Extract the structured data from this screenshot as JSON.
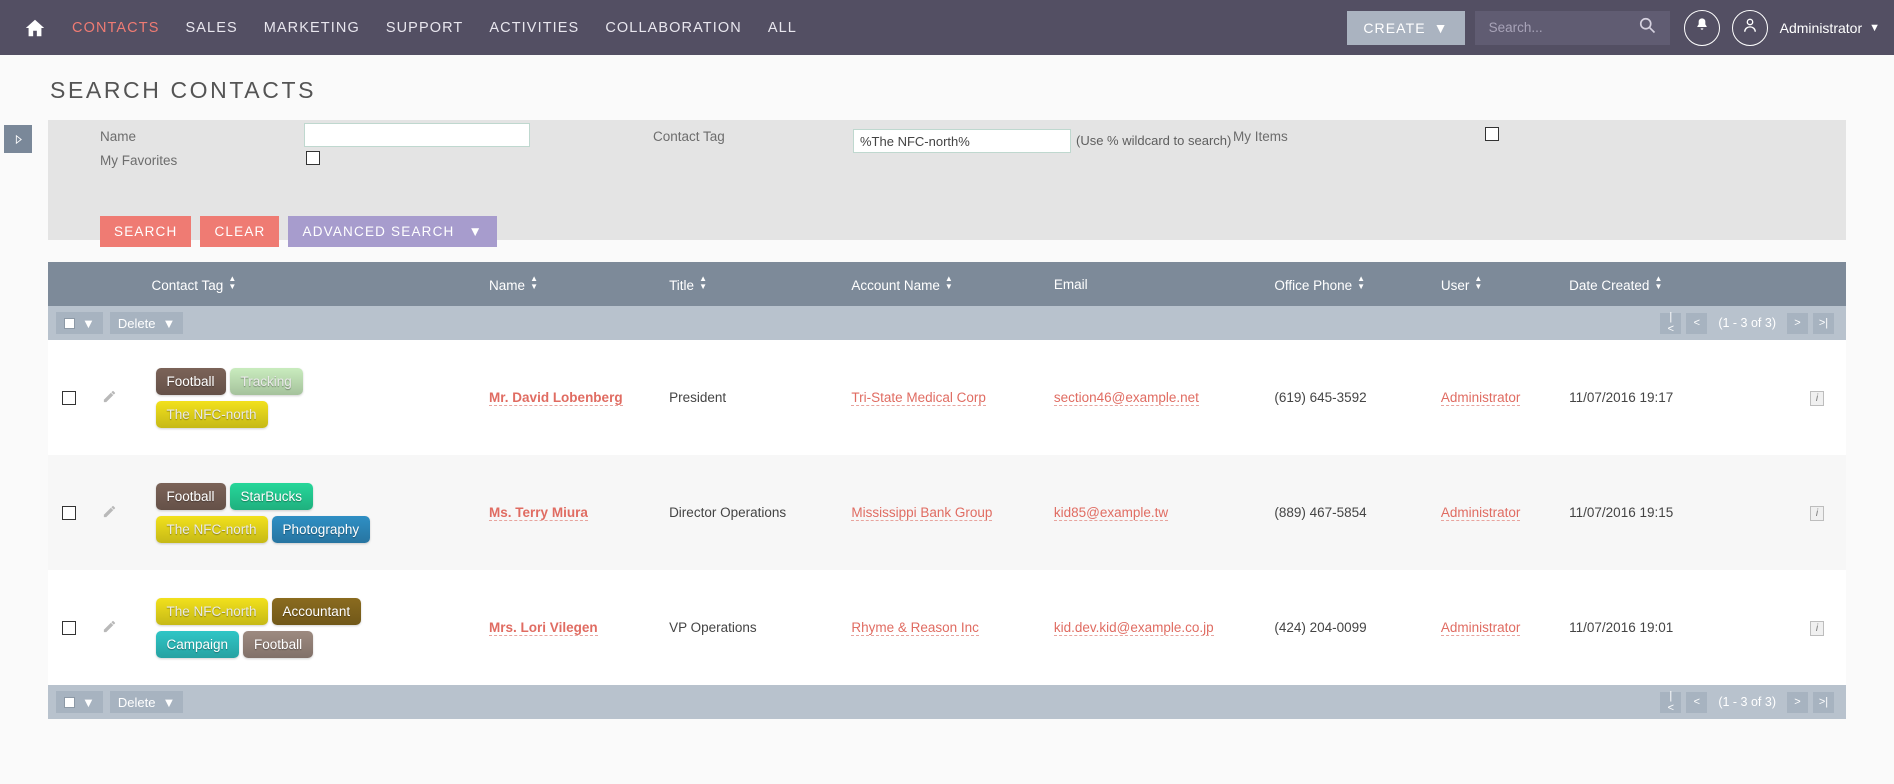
{
  "header": {
    "home_icon": "home-icon",
    "nav": [
      {
        "label": "CONTACTS",
        "active": true
      },
      {
        "label": "SALES",
        "active": false
      },
      {
        "label": "MARKETING",
        "active": false
      },
      {
        "label": "SUPPORT",
        "active": false
      },
      {
        "label": "ACTIVITIES",
        "active": false
      },
      {
        "label": "COLLABORATION",
        "active": false
      },
      {
        "label": "ALL",
        "active": false
      }
    ],
    "create_label": "CREATE",
    "create_caret": "▼",
    "search_placeholder": "Search...",
    "search_value": "",
    "search_icon": "search-icon",
    "bell_icon": "bell-icon",
    "avatar_icon": "user-avatar-icon",
    "user_name": "Administrator",
    "user_caret": "▼",
    "accent_color": "#ef7b73",
    "nav_bg": "#534f63"
  },
  "sidebar_toggle": {
    "icon": "expand-sidebar-icon",
    "glyph": "▷"
  },
  "page": {
    "title": "SEARCH CONTACTS"
  },
  "search_form": {
    "name_label": "Name",
    "name_value": "",
    "name_placeholder": "",
    "my_favorites_label": "My Favorites",
    "my_favorites_checked": false,
    "contact_tag_label": "Contact Tag",
    "contact_tag_value": "%The NFC-north%",
    "wildcard_hint": "(Use % wildcard to search)",
    "my_items_label": "My Items",
    "my_items_checked": false,
    "search_button": "SEARCH",
    "clear_button": "CLEAR",
    "advanced_button": "ADVANCED SEARCH",
    "advanced_caret": "▼"
  },
  "table": {
    "columns": [
      {
        "label": "",
        "sortable": false
      },
      {
        "label": "Contact Tag",
        "sortable": true
      },
      {
        "label": "Name",
        "sortable": true
      },
      {
        "label": "Title",
        "sortable": true
      },
      {
        "label": "Account Name",
        "sortable": true
      },
      {
        "label": "Email",
        "sortable": false
      },
      {
        "label": "Office Phone",
        "sortable": true
      },
      {
        "label": "User",
        "sortable": true
      },
      {
        "label": "Date Created",
        "sortable": true
      },
      {
        "label": "",
        "sortable": false
      }
    ],
    "toolbar": {
      "select_all_caret": "▼",
      "delete_label": "Delete",
      "delete_caret": "▼",
      "first_page": "|<",
      "prev_page": "<",
      "page_count": "(1 - 3 of 3)",
      "next_page": ">",
      "last_page": ">|"
    },
    "rows": [
      {
        "selected": false,
        "edit_icon": "pencil-edit-icon",
        "tags": [
          {
            "label": "Football",
            "color": "#7b6358"
          },
          {
            "label": "Tracking",
            "color": "#c9ecbe"
          },
          {
            "label": "The NFC-north",
            "color": "#f2e11c"
          }
        ],
        "name": "Mr. David Lobenberg",
        "title": "President",
        "account_name": "Tri-State Medical Corp",
        "email": "section46@example.net",
        "office_phone": "(619) 645-3592",
        "user": "Administrator",
        "date_created": "11/07/2016 19:17",
        "info_icon": "info-icon",
        "info_glyph": "i"
      },
      {
        "selected": false,
        "edit_icon": "pencil-edit-icon",
        "tags": [
          {
            "label": "Football",
            "color": "#7b6358"
          },
          {
            "label": "StarBucks",
            "color": "#26d79a"
          },
          {
            "label": "The NFC-north",
            "color": "#f2e11c"
          },
          {
            "label": "Photography",
            "color": "#2f8fc4"
          }
        ],
        "name": "Ms. Terry Miura",
        "title": "Director Operations",
        "account_name": "Mississippi Bank Group",
        "email": "kid85@example.tw",
        "office_phone": "(889) 467-5854",
        "user": "Administrator",
        "date_created": "11/07/2016 19:15",
        "info_icon": "info-icon",
        "info_glyph": "i"
      },
      {
        "selected": false,
        "edit_icon": "pencil-edit-icon",
        "tags": [
          {
            "label": "The NFC-north",
            "color": "#f2e11c"
          },
          {
            "label": "Accountant",
            "color": "#8a6b1f"
          },
          {
            "label": "Campaign",
            "color": "#2fc6c6"
          },
          {
            "label": "Football",
            "color": "#9d8a80"
          }
        ],
        "name": "Mrs. Lori Vilegen",
        "title": "VP Operations",
        "account_name": "Rhyme & Reason Inc",
        "email": "kid.dev.kid@example.co.jp",
        "office_phone": "(424) 204-0099",
        "user": "Administrator",
        "date_created": "11/07/2016 19:01",
        "info_icon": "info-icon",
        "info_glyph": "i"
      }
    ]
  }
}
